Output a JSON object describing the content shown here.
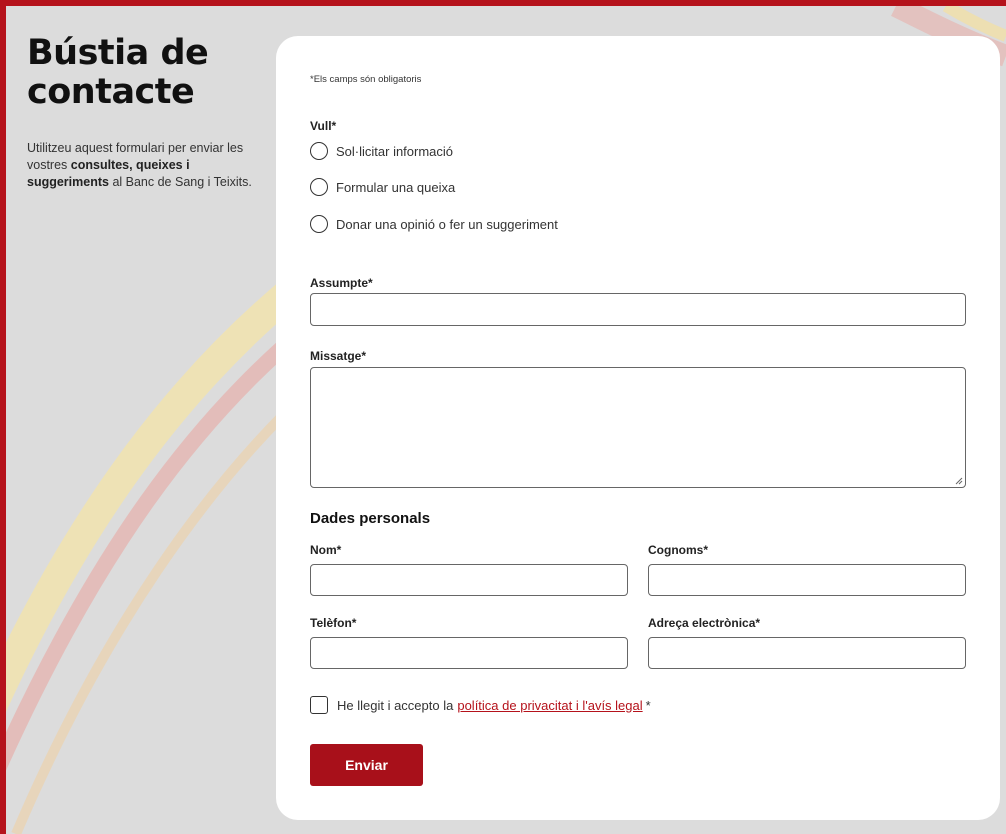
{
  "intro": {
    "title": "Bústia de contacte",
    "description_before": "Utilitzeu aquest formulari per enviar les vostres ",
    "description_bold_1": "consultes, queixes i suggeriments",
    "description_after": " al Banc de Sang i Teixits."
  },
  "form": {
    "required_note": "*Els camps són obligatoris",
    "want_label": "Vull*",
    "options": [
      "Sol·licitar informació",
      "Formular una queixa",
      "Donar una opinió o fer un suggeriment"
    ],
    "subject_label": "Assumpte*",
    "subject_value": "",
    "message_label": "Missatge*",
    "message_value": "",
    "personal_title": "Dades personals",
    "name_label": "Nom*",
    "surname_label": "Cognoms*",
    "phone_label": "Telèfon*",
    "email_label": "Adreça electrònica*",
    "consent_text": "He llegit i accepto la",
    "consent_link": "política de privacitat i l'avís legal",
    "consent_star": "*",
    "submit_label": "Enviar"
  },
  "colors": {
    "brand_red": "#b5121b",
    "button_red": "#a8101a",
    "background_gray": "#dcdcdc"
  }
}
